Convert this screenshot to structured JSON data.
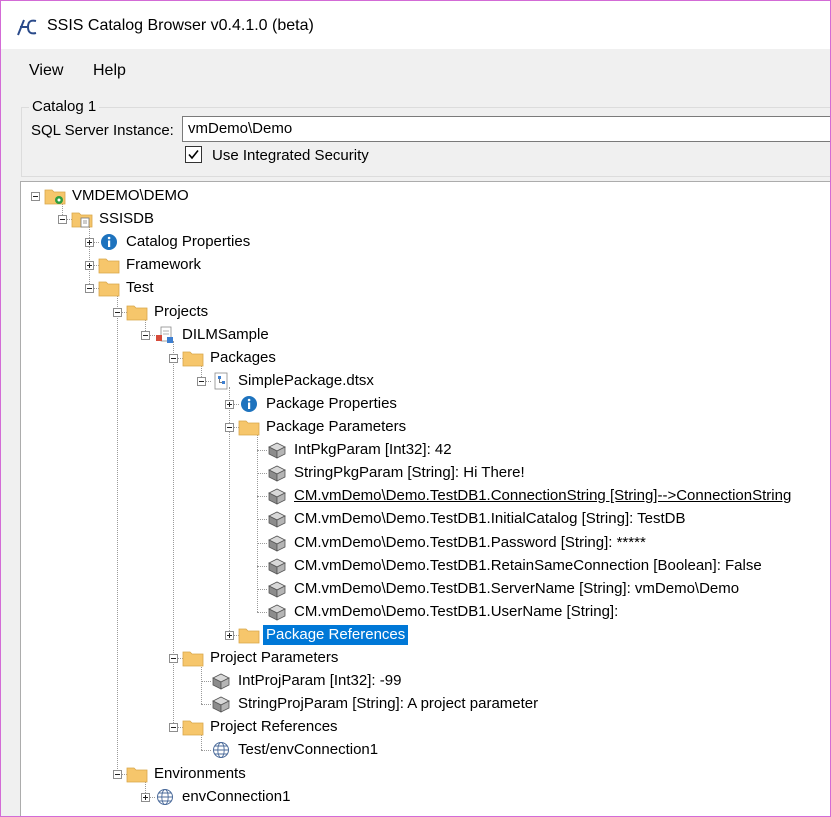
{
  "window": {
    "title": "SSIS Catalog Browser v0.4.1.0 (beta)"
  },
  "menu": {
    "items": [
      "View",
      "Help"
    ]
  },
  "catalog": {
    "group_label": "Catalog 1",
    "instance_label": "SQL Server Instance:",
    "instance_value": "vmDemo\\Demo",
    "integrated_security_label": "Use Integrated Security",
    "integrated_security_checked": true
  },
  "tree": {
    "nodes": [
      {
        "label": "VMDEMO\\DEMO",
        "icon": "server-icon",
        "expander": "collapse"
      },
      {
        "label": "SSISDB",
        "icon": "database-icon",
        "expander": "collapse"
      },
      {
        "label": "Catalog Properties",
        "icon": "info-icon",
        "expander": "expand"
      },
      {
        "label": "Framework",
        "icon": "folder-icon",
        "expander": "expand"
      },
      {
        "label": "Test",
        "icon": "folder-icon",
        "expander": "collapse"
      },
      {
        "label": "Projects",
        "icon": "folder-icon",
        "expander": "collapse"
      },
      {
        "label": "DILMSample",
        "icon": "project-icon",
        "expander": "collapse"
      },
      {
        "label": "Packages",
        "icon": "folder-icon",
        "expander": "collapse"
      },
      {
        "label": "SimplePackage.dtsx",
        "icon": "package-icon",
        "expander": "collapse"
      },
      {
        "label": "Package Properties",
        "icon": "info-icon",
        "expander": "expand"
      },
      {
        "label": "Package Parameters",
        "icon": "folder-icon",
        "expander": "collapse"
      },
      {
        "label": "IntPkgParam [Int32]: 42",
        "icon": "parameter-icon"
      },
      {
        "label": "StringPkgParam [String]: Hi There!",
        "icon": "parameter-icon"
      },
      {
        "label": "CM.vmDemo\\Demo.TestDB1.ConnectionString [String]-->ConnectionString",
        "icon": "parameter-icon",
        "underline": true
      },
      {
        "label": "CM.vmDemo\\Demo.TestDB1.InitialCatalog [String]: TestDB",
        "icon": "parameter-icon"
      },
      {
        "label": "CM.vmDemo\\Demo.TestDB1.Password [String]: *****",
        "icon": "parameter-icon"
      },
      {
        "label": "CM.vmDemo\\Demo.TestDB1.RetainSameConnection [Boolean]: False",
        "icon": "parameter-icon"
      },
      {
        "label": "CM.vmDemo\\Demo.TestDB1.ServerName [String]: vmDemo\\Demo",
        "icon": "parameter-icon"
      },
      {
        "label": "CM.vmDemo\\Demo.TestDB1.UserName [String]:",
        "icon": "parameter-icon"
      },
      {
        "label": "Package References",
        "icon": "folder-icon",
        "expander": "expand",
        "selected": true
      },
      {
        "label": "Project Parameters",
        "icon": "folder-icon",
        "expander": "collapse"
      },
      {
        "label": "IntProjParam [Int32]: -99",
        "icon": "parameter-icon"
      },
      {
        "label": "StringProjParam [String]: A project parameter",
        "icon": "parameter-icon"
      },
      {
        "label": "Project References",
        "icon": "folder-icon",
        "expander": "collapse"
      },
      {
        "label": "Test/envConnection1",
        "icon": "globe-icon"
      },
      {
        "label": "Environments",
        "icon": "folder-icon",
        "expander": "collapse"
      },
      {
        "label": "envConnection1",
        "icon": "globe-icon",
        "expander": "expand"
      }
    ]
  },
  "colors": {
    "selection": "#0078d7",
    "folder": "#f6c66b",
    "info": "#1e73be",
    "window_border": "#d36bd6"
  }
}
